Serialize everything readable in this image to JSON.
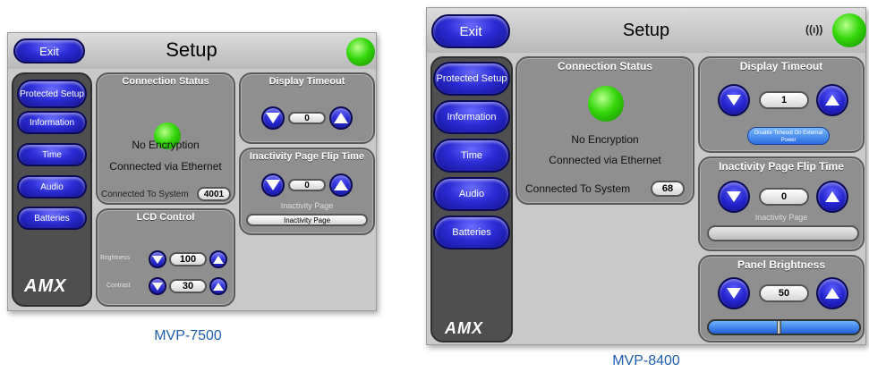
{
  "left": {
    "caption": "MVP-7500",
    "header": {
      "exit_label": "Exit",
      "title": "Setup"
    },
    "sidebar": {
      "items": [
        {
          "label": "Protected Setup"
        },
        {
          "label": "Information"
        },
        {
          "label": "Time"
        },
        {
          "label": "Audio"
        },
        {
          "label": "Batteries"
        }
      ],
      "logo": "AMX"
    },
    "connection": {
      "title": "Connection Status",
      "encryption": "No Encryption",
      "connected_via": "Connected via Ethernet",
      "system_label": "Connected To System",
      "system_value": "4001"
    },
    "display_timeout": {
      "title": "Display Timeout",
      "value": "0"
    },
    "inactivity": {
      "title": "Inactivity Page Flip Time",
      "value": "0",
      "page_label": "Inactivity Page",
      "page_value": "Inactivity Page"
    },
    "lcd": {
      "title": "LCD Control",
      "brightness_label": "Brightness",
      "brightness_value": "100",
      "contrast_label": "Contrast",
      "contrast_value": "30"
    }
  },
  "right": {
    "caption": "MVP-8400",
    "header": {
      "exit_label": "Exit",
      "title": "Setup",
      "wireless_icon": "((ı))"
    },
    "sidebar": {
      "items": [
        {
          "label": "Protected Setup"
        },
        {
          "label": "Information"
        },
        {
          "label": "Time"
        },
        {
          "label": "Audio"
        },
        {
          "label": "Batteries"
        }
      ],
      "logo": "AMX"
    },
    "connection": {
      "title": "Connection Status",
      "encryption": "No Encryption",
      "connected_via": "Connected via Ethernet",
      "system_label": "Connected To System",
      "system_value": "68"
    },
    "display_timeout": {
      "title": "Display Timeout",
      "value": "1",
      "disable_label": "Disable Timeout On External Power"
    },
    "inactivity": {
      "title": "Inactivity Page Flip Time",
      "value": "0",
      "page_label": "Inactivity Page"
    },
    "brightness": {
      "title": "Panel Brightness",
      "value": "50",
      "level": 0.47
    }
  },
  "colors": {
    "accent_blue": "#2426d0",
    "status_green": "#35d70a",
    "caption_blue": "#1f5fb0"
  }
}
